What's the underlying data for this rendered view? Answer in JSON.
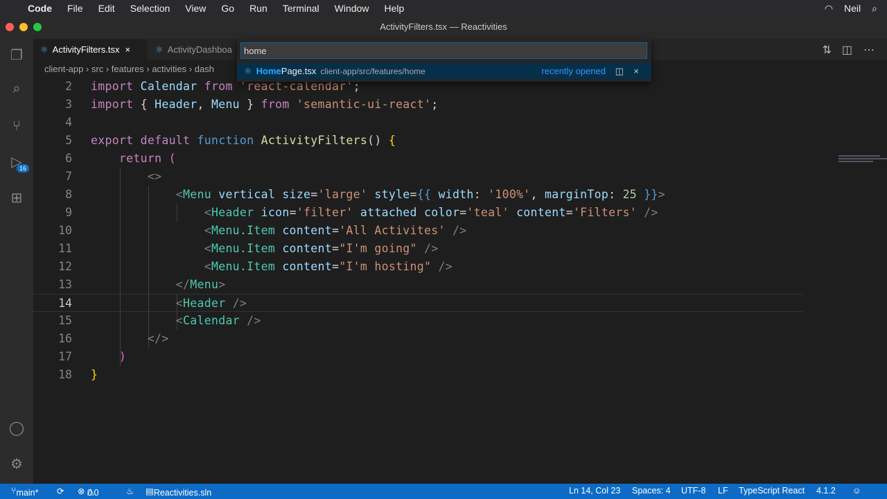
{
  "menubar": {
    "app": "Code",
    "items": [
      "File",
      "Edit",
      "Selection",
      "View",
      "Go",
      "Run",
      "Terminal",
      "Window",
      "Help"
    ],
    "user": "Neil"
  },
  "window_title": "ActivityFilters.tsx — Reactivities",
  "tabs": [
    {
      "label": "ActivityFilters.tsx",
      "active": true
    },
    {
      "label": "ActivityDashboa"
    }
  ],
  "breadcrumb": "client-app › src › features › activities › dash",
  "activity": {
    "source_control_badge": "16"
  },
  "quick_open": {
    "value": "home",
    "result_match": "Home",
    "result_rest": "Page.tsx",
    "result_path": "client-app/src/features/home",
    "result_tag": "recently opened"
  },
  "editor": {
    "lines": [
      {
        "n": "2",
        "t": [
          [
            "import ",
            "k"
          ],
          [
            "Calendar ",
            "a"
          ],
          [
            "from ",
            "k"
          ],
          [
            "'react-calendar'",
            "s"
          ],
          [
            ";",
            "w"
          ]
        ]
      },
      {
        "n": "3",
        "t": [
          [
            "import ",
            "k"
          ],
          [
            "{ ",
            "w"
          ],
          [
            "Header",
            "a"
          ],
          [
            ", ",
            "w"
          ],
          [
            "Menu ",
            "a"
          ],
          [
            "} ",
            "w"
          ],
          [
            "from ",
            "k"
          ],
          [
            "'semantic-ui-react'",
            "s"
          ],
          [
            ";",
            "w"
          ]
        ]
      },
      {
        "n": "4",
        "t": []
      },
      {
        "n": "5",
        "t": [
          [
            "export ",
            "k"
          ],
          [
            "default ",
            "k"
          ],
          [
            "function ",
            "b"
          ],
          [
            "ActivityFilters",
            "f"
          ],
          [
            "() ",
            "w"
          ],
          [
            "{",
            "y"
          ]
        ]
      },
      {
        "n": "6",
        "t": [
          [
            "    return ",
            "k"
          ],
          [
            "(",
            "m"
          ]
        ]
      },
      {
        "n": "7",
        "t": [
          [
            "        <>",
            "p"
          ]
        ]
      },
      {
        "n": "8",
        "t": [
          [
            "            <",
            "p"
          ],
          [
            "Menu ",
            "t"
          ],
          [
            "vertical ",
            "a"
          ],
          [
            "size",
            "a"
          ],
          [
            "=",
            "w"
          ],
          [
            "'large' ",
            "s"
          ],
          [
            "style",
            "a"
          ],
          [
            "=",
            "w"
          ],
          [
            "{{ ",
            "b"
          ],
          [
            "width",
            "a"
          ],
          [
            ": ",
            "w"
          ],
          [
            "'100%'",
            "s"
          ],
          [
            ", ",
            "w"
          ],
          [
            "marginTop",
            "a"
          ],
          [
            ": ",
            "w"
          ],
          [
            "25 ",
            "n"
          ],
          [
            "}}",
            "b"
          ],
          [
            ">",
            "p"
          ]
        ]
      },
      {
        "n": "9",
        "t": [
          [
            "                <",
            "p"
          ],
          [
            "Header ",
            "t"
          ],
          [
            "icon",
            "a"
          ],
          [
            "=",
            "w"
          ],
          [
            "'filter' ",
            "s"
          ],
          [
            "attached ",
            "a"
          ],
          [
            "color",
            "a"
          ],
          [
            "=",
            "w"
          ],
          [
            "'teal' ",
            "s"
          ],
          [
            "content",
            "a"
          ],
          [
            "=",
            "w"
          ],
          [
            "'Filters' ",
            "s"
          ],
          [
            "/>",
            "p"
          ]
        ]
      },
      {
        "n": "10",
        "t": [
          [
            "                <",
            "p"
          ],
          [
            "Menu.Item ",
            "t"
          ],
          [
            "content",
            "a"
          ],
          [
            "=",
            "w"
          ],
          [
            "'All Activites' ",
            "s"
          ],
          [
            "/>",
            "p"
          ]
        ]
      },
      {
        "n": "11",
        "t": [
          [
            "                <",
            "p"
          ],
          [
            "Menu.Item ",
            "t"
          ],
          [
            "content",
            "a"
          ],
          [
            "=",
            "w"
          ],
          [
            "\"I'm going\" ",
            "s"
          ],
          [
            "/>",
            "p"
          ]
        ]
      },
      {
        "n": "12",
        "t": [
          [
            "                <",
            "p"
          ],
          [
            "Menu.Item ",
            "t"
          ],
          [
            "content",
            "a"
          ],
          [
            "=",
            "w"
          ],
          [
            "\"I'm hosting\" ",
            "s"
          ],
          [
            "/>",
            "p"
          ]
        ]
      },
      {
        "n": "13",
        "t": [
          [
            "            </",
            "p"
          ],
          [
            "Menu",
            "t"
          ],
          [
            ">",
            "p"
          ]
        ]
      },
      {
        "n": "14",
        "t": [
          [
            "            <",
            "p"
          ],
          [
            "Header ",
            "t"
          ],
          [
            "/>",
            "p"
          ]
        ],
        "current": true
      },
      {
        "n": "15",
        "t": [
          [
            "            <",
            "p"
          ],
          [
            "Calendar ",
            "t"
          ],
          [
            "/>",
            "p"
          ]
        ]
      },
      {
        "n": "16",
        "t": [
          [
            "        </>",
            "p"
          ]
        ]
      },
      {
        "n": "17",
        "t": [
          [
            "    )",
            "m"
          ]
        ]
      },
      {
        "n": "18",
        "t": [
          [
            "}",
            "y"
          ]
        ]
      }
    ]
  },
  "status": {
    "branch": "main*",
    "errors": "0",
    "warnings": "0",
    "solution": "Reactivities.sln",
    "position": "Ln 14, Col 23",
    "spaces": "Spaces: 4",
    "encoding": "UTF-8",
    "eol": "LF",
    "language": "TypeScript React",
    "version": "4.1.2"
  }
}
